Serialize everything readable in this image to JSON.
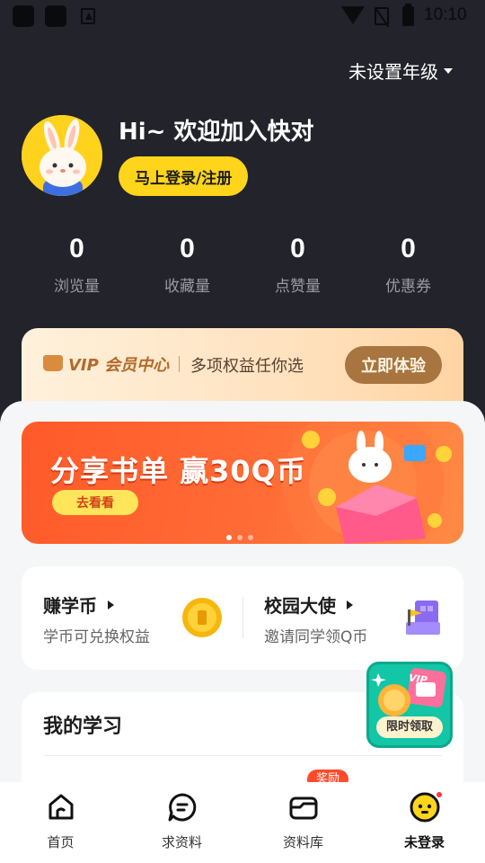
{
  "status_bar": {
    "time": "10:10"
  },
  "header": {
    "grade_selector": "未设置年级",
    "greeting": "Hi~ 欢迎加入快对",
    "login_button": "马上登录/注册"
  },
  "stats": [
    {
      "value": "0",
      "label": "浏览量"
    },
    {
      "value": "0",
      "label": "收藏量"
    },
    {
      "value": "0",
      "label": "点赞量"
    },
    {
      "value": "0",
      "label": "优惠券"
    }
  ],
  "vip": {
    "title": "VIP 会员中心",
    "subtitle": "多项权益任你选",
    "button": "立即体验"
  },
  "promo_banner": {
    "title": "分享书单 赢30Q币",
    "button": "去看看",
    "slides": 3,
    "active_slide": 1
  },
  "rewards": [
    {
      "title": "赚学币",
      "subtitle": "学币可兑换权益",
      "icon": "coin-icon"
    },
    {
      "title": "校园大使",
      "subtitle": "邀请同学领Q币",
      "icon": "flag-building-icon"
    }
  ],
  "study": {
    "title": "我的学习",
    "tag": "奖励"
  },
  "floating_promo": {
    "label": "限时领取",
    "badge": "VIP"
  },
  "bottom_nav": [
    {
      "label": "首页",
      "icon": "home-icon"
    },
    {
      "label": "求资料",
      "icon": "chat-icon"
    },
    {
      "label": "资料库",
      "icon": "folder-icon"
    },
    {
      "label": "未登录",
      "icon": "avatar-face-icon",
      "active": true
    }
  ],
  "colors": {
    "header_bg": "#22232b",
    "accent_yellow": "#ffd51c",
    "promo_orange": "#ff5a2a",
    "vip_brown": "#a8743f"
  }
}
